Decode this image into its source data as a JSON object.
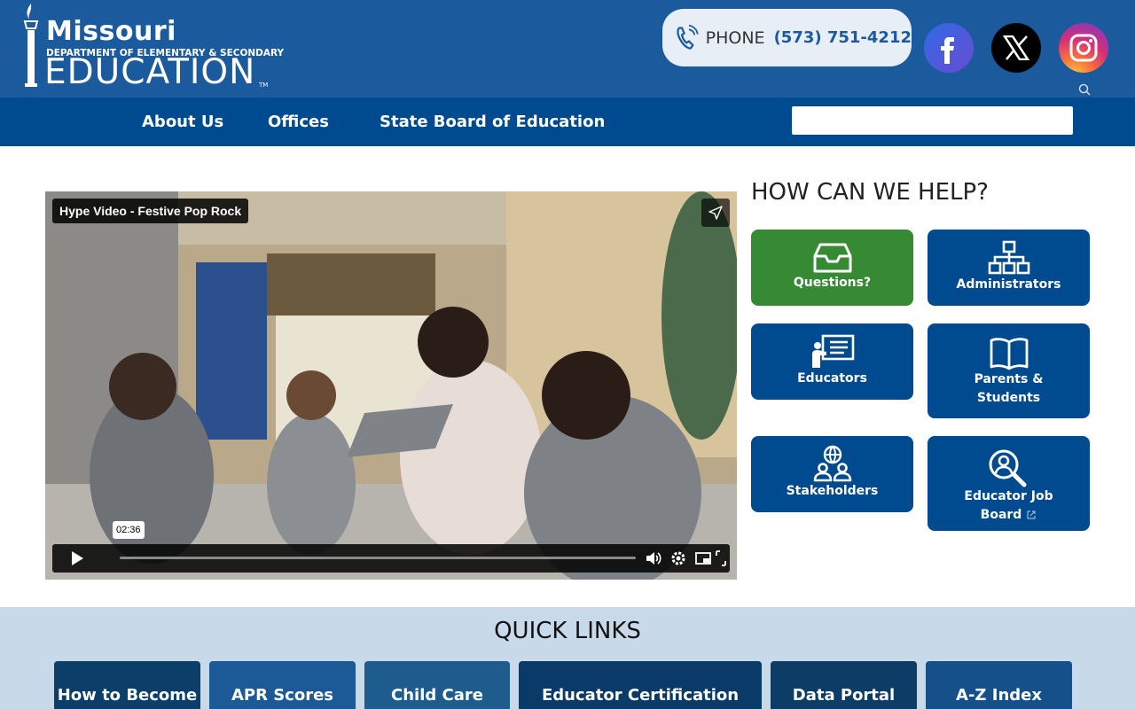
{
  "header": {
    "logo": {
      "state": "Missouri",
      "department": "DEPARTMENT OF ELEMENTARY & SECONDARY",
      "education": "EDUCATION",
      "tm": "TM"
    },
    "phone": {
      "label": "PHONE",
      "number": "(573) 751-4212",
      "icon": "phone-icon"
    },
    "social": [
      {
        "name": "facebook",
        "icon": "facebook-icon",
        "color": "#3b5ee0"
      },
      {
        "name": "x",
        "icon": "x-icon",
        "color": "#000000"
      },
      {
        "name": "instagram",
        "icon": "instagram-icon",
        "color": "#d62d78"
      }
    ]
  },
  "nav": {
    "items": [
      {
        "label": "About Us"
      },
      {
        "label": "Offices"
      },
      {
        "label": "State Board of Education"
      }
    ],
    "search": {
      "placeholder": "",
      "icon": "search-icon"
    }
  },
  "video": {
    "title": "Hype Video - Festive Pop Rock",
    "time": "02:36"
  },
  "help": {
    "title": "HOW CAN WE HELP?",
    "tiles": [
      {
        "label": "Questions?",
        "icon": "inbox-icon",
        "color": "#368a33"
      },
      {
        "label": "Administrators",
        "icon": "org-chart-icon",
        "color": "#004a8f"
      },
      {
        "label": "Educators",
        "icon": "teacher-board-icon",
        "color": "#004a8f"
      },
      {
        "label": "Parents &",
        "label2": "Students",
        "icon": "book-icon",
        "color": "#004a8f"
      },
      {
        "label": "Stakeholders",
        "icon": "group-globe-icon",
        "color": "#004a8f"
      },
      {
        "label": "Educator Job",
        "label2": "Board",
        "icon": "search-person-icon",
        "color": "#004a8f"
      }
    ]
  },
  "quick_links": {
    "title": "QUICK LINKS",
    "items": [
      {
        "label": "How to Become"
      },
      {
        "label": "APR Scores"
      },
      {
        "label": "Child Care"
      },
      {
        "label": "Educator Certification"
      },
      {
        "label": "Data Portal"
      },
      {
        "label": "A-Z Index"
      }
    ]
  },
  "colors": {
    "header_bg": "#1b5a9c",
    "nav_bg": "#004a8f",
    "tile_blue": "#004a8f",
    "tile_green": "#368a33",
    "quick_bg": "#c8daea"
  }
}
